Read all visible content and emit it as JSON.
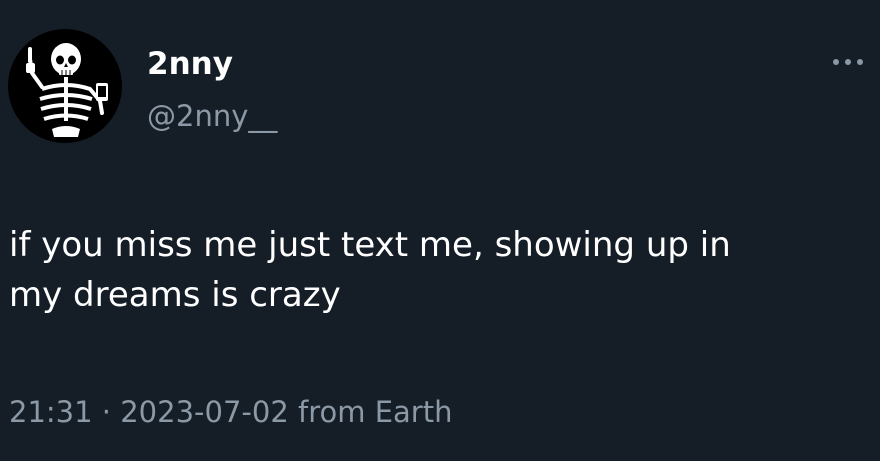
{
  "colors": {
    "background": "#151e27",
    "primary_text": "#ffffff",
    "secondary_text": "#8b98a5"
  },
  "author": {
    "display_name": "2nny",
    "handle": "@2nny__",
    "avatar_icon": "skeleton-avatar-icon"
  },
  "more_icon": "more-dots-icon",
  "tweet": {
    "lines": [
      "if you miss me just text me, showing up in",
      "my dreams is crazy"
    ]
  },
  "meta": {
    "time": "21:31",
    "separator": " · ",
    "date": "2023-07-02",
    "source": " from Earth"
  }
}
